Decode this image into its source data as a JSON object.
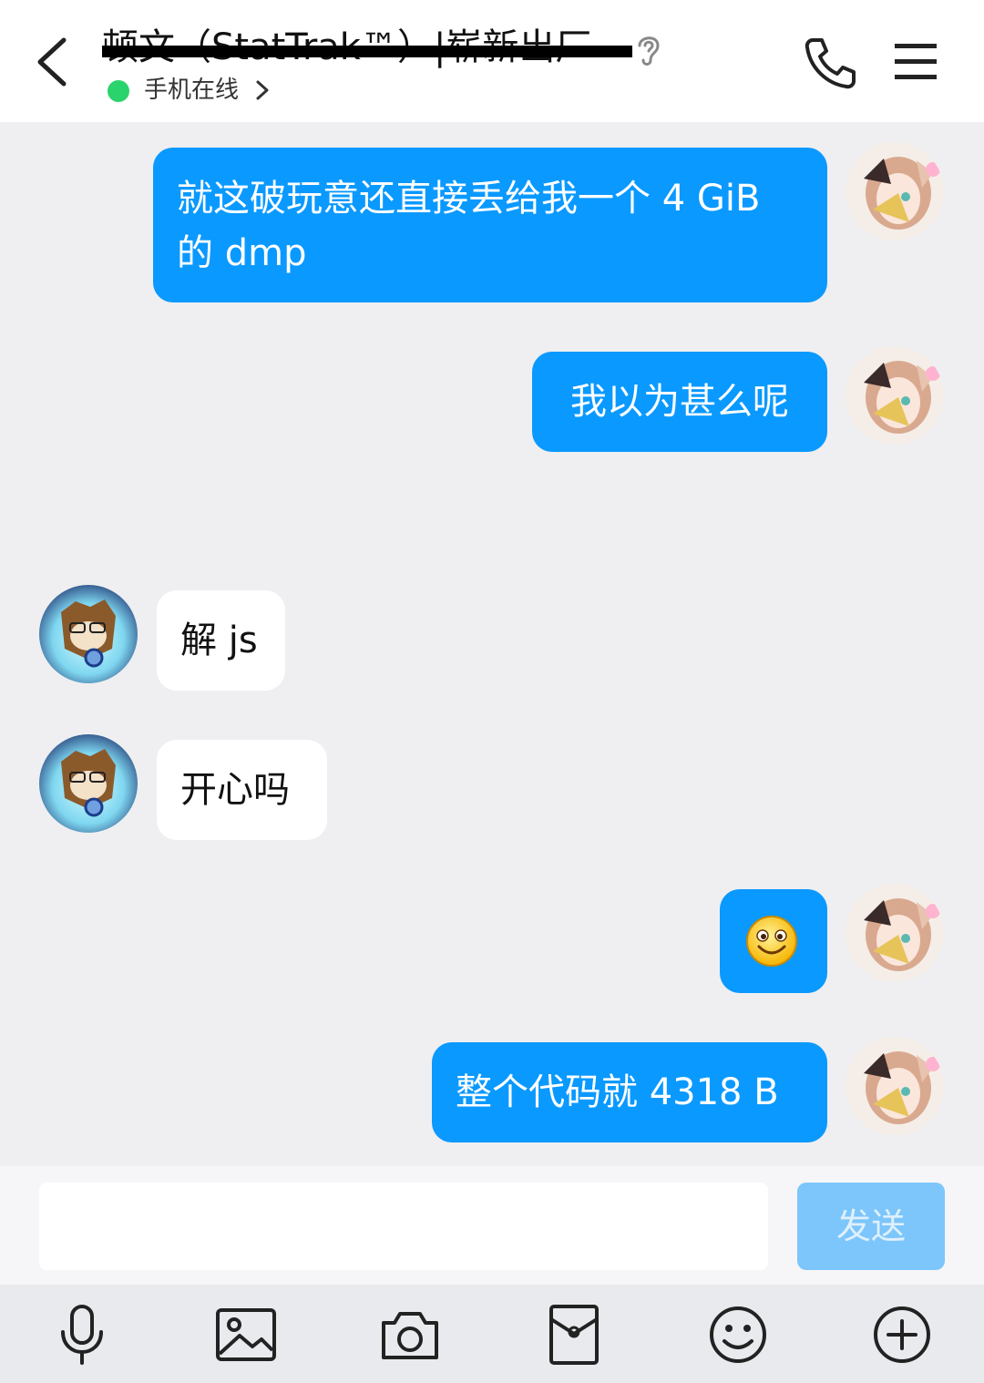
{
  "header": {
    "title": "顿文（StatTrak™）|崭新出厂",
    "status": "手机在线",
    "icons": [
      "back-arrow-icon",
      "ear-icon",
      "chevron-right-icon",
      "phone-icon",
      "menu-icon"
    ]
  },
  "messages": [
    {
      "side": "right",
      "text": "就这破玩意还直接丢给我一个 4 GiB 的 dmp"
    },
    {
      "side": "right",
      "text": "我以为甚么呢"
    },
    {
      "side": "left",
      "text": "解 js"
    },
    {
      "side": "left",
      "text": "开心吗"
    },
    {
      "side": "right",
      "text": "",
      "emoji": "smile-emoji"
    },
    {
      "side": "right",
      "text": "整个代码就 4318 B"
    }
  ],
  "input": {
    "value": "",
    "placeholder": "",
    "send_label": "发送"
  },
  "toolbar": [
    "microphone-icon",
    "image-icon",
    "camera-icon",
    "red-packet-icon",
    "emoji-icon",
    "plus-icon"
  ],
  "colors": {
    "bubble_out": "#0a99ff",
    "bubble_in": "#ffffff",
    "background": "#efeff1",
    "send_disabled": "#7cc6fb",
    "online": "#2bd36c"
  }
}
